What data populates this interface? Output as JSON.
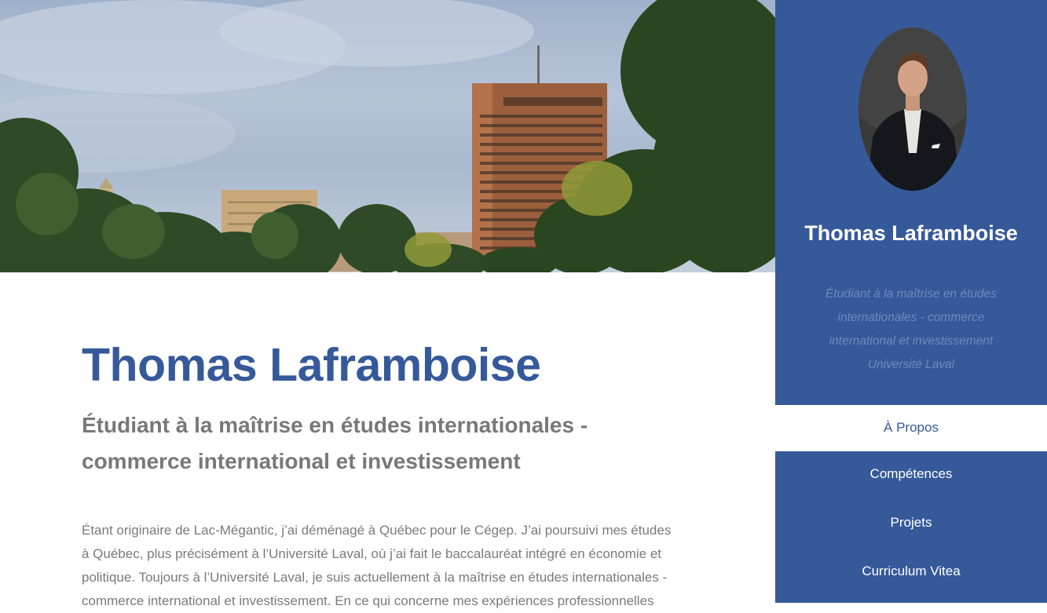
{
  "hero": {
    "image": "city-skyline-with-trees-photo"
  },
  "main": {
    "title": "Thomas Laframboise",
    "subtitle": "Étudiant à la maîtrise en études internationales - commerce international et investissement",
    "bio": "Étant originaire de Lac-Mégantic, j’ai déménagé à Québec pour le Cégep. J’ai poursuivi mes études à Québec, plus précisément à l’Université Laval, où j’ai fait le baccalauréat intégré en économie et politique. Toujours à l’Université Laval, je suis actuellement à la maîtrise en études internationales - commerce international et investissement. En ce qui concerne mes expériences professionnelles"
  },
  "sidebar": {
    "name": "Thomas Laframboise",
    "tagline": "Étudiant à la maîtrise en études internationales - commerce international et investissement Université Laval",
    "nav": [
      {
        "label": "À Propos",
        "active": true
      },
      {
        "label": "Compétences",
        "active": false
      },
      {
        "label": "Projets",
        "active": false
      },
      {
        "label": "Curriculum Vitea",
        "active": false
      }
    ]
  },
  "colors": {
    "accent": "#36599a",
    "title": "#36599a",
    "subtitle": "#787878",
    "body_text": "#7a7a7a",
    "tagline": "#6f88b8"
  }
}
